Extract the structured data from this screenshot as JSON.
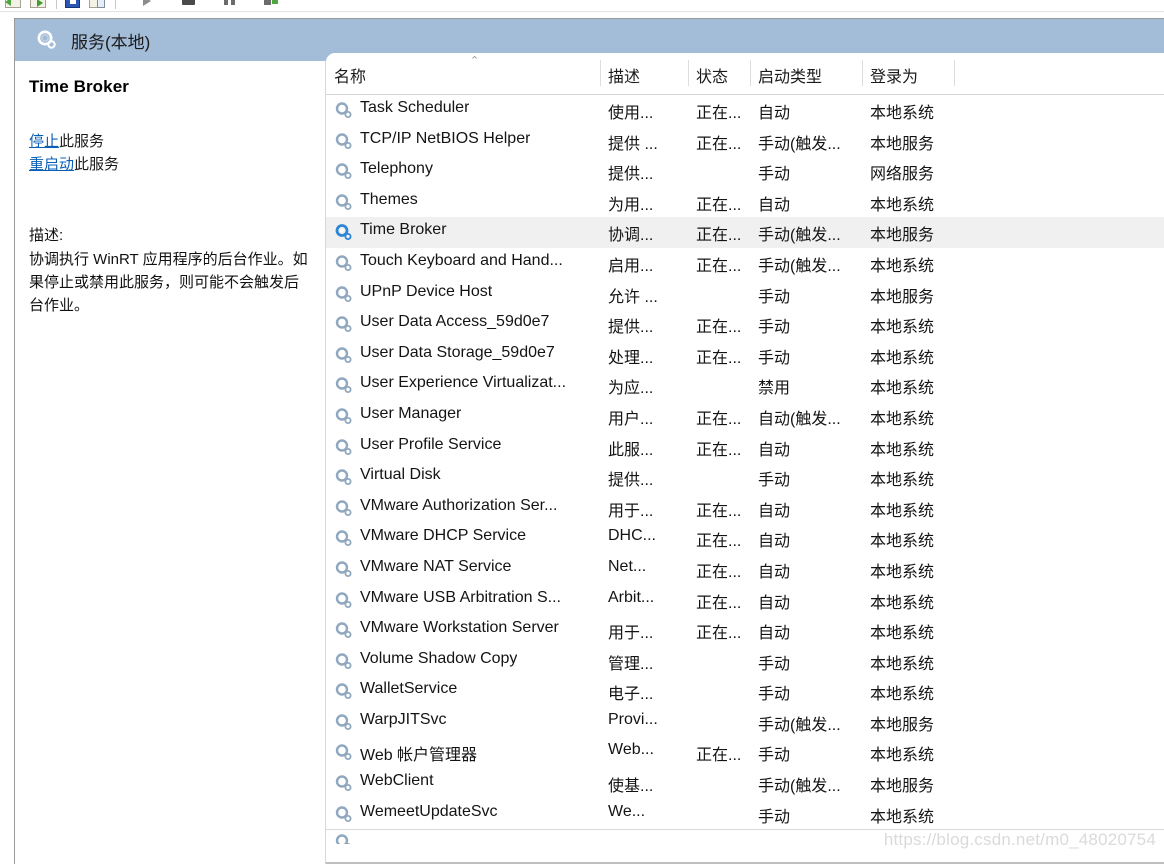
{
  "toolbar": {
    "buttons": [
      {
        "name": "export-list-icon",
        "kind": "doc-green-left"
      },
      {
        "name": "properties-icon",
        "kind": "doc-green-right"
      },
      {
        "name": "help-icon",
        "kind": "blue-square"
      },
      {
        "name": "show-hide-console-tree-icon",
        "kind": "doc-split"
      },
      {
        "name": "start-service-icon",
        "kind": "play"
      },
      {
        "name": "stop-service-icon",
        "kind": "stop"
      },
      {
        "name": "pause-service-icon",
        "kind": "pause"
      },
      {
        "name": "restart-service-icon",
        "kind": "restart"
      }
    ]
  },
  "header": {
    "icon": "services-gear-icon",
    "title": "服务(本地)"
  },
  "details": {
    "service_name": "Time Broker",
    "links": [
      {
        "link_text": "停止",
        "suffix": "此服务"
      },
      {
        "link_text": "重启动",
        "suffix": "此服务"
      }
    ],
    "description_label": "描述:",
    "description_text": "协调执行 WinRT 应用程序的后台作业。如果停止或禁用此服务，则可能不会触发后台作业。"
  },
  "list": {
    "sort_caret": "⌃",
    "columns": [
      {
        "key": "name",
        "label": "名称"
      },
      {
        "key": "desc",
        "label": "描述"
      },
      {
        "key": "state",
        "label": "状态"
      },
      {
        "key": "start",
        "label": "启动类型"
      },
      {
        "key": "logon",
        "label": "登录为"
      }
    ],
    "selected_index": 4,
    "rows": [
      {
        "icon": "service-gear-icon",
        "name": "Task Scheduler",
        "desc": "使用...",
        "state": "正在...",
        "start": "自动",
        "logon": "本地系统"
      },
      {
        "icon": "service-gear-icon",
        "name": "TCP/IP NetBIOS Helper",
        "desc": "提供 ...",
        "state": "正在...",
        "start": "手动(触发...",
        "logon": "本地服务"
      },
      {
        "icon": "service-gear-icon",
        "name": "Telephony",
        "desc": "提供...",
        "state": "",
        "start": "手动",
        "logon": "网络服务"
      },
      {
        "icon": "service-gear-icon",
        "name": "Themes",
        "desc": "为用...",
        "state": "正在...",
        "start": "自动",
        "logon": "本地系统"
      },
      {
        "icon": "service-gear-icon",
        "name": "Time Broker",
        "desc": "协调...",
        "state": "正在...",
        "start": "手动(触发...",
        "logon": "本地服务"
      },
      {
        "icon": "service-gear-icon",
        "name": "Touch Keyboard and Hand...",
        "desc": "启用...",
        "state": "正在...",
        "start": "手动(触发...",
        "logon": "本地系统"
      },
      {
        "icon": "service-gear-icon",
        "name": "UPnP Device Host",
        "desc": "允许 ...",
        "state": "",
        "start": "手动",
        "logon": "本地服务"
      },
      {
        "icon": "service-gear-icon",
        "name": "User Data Access_59d0e7",
        "desc": "提供...",
        "state": "正在...",
        "start": "手动",
        "logon": "本地系统"
      },
      {
        "icon": "service-gear-icon",
        "name": "User Data Storage_59d0e7",
        "desc": "处理...",
        "state": "正在...",
        "start": "手动",
        "logon": "本地系统"
      },
      {
        "icon": "service-gear-icon",
        "name": "User Experience Virtualizat...",
        "desc": "为应...",
        "state": "",
        "start": "禁用",
        "logon": "本地系统"
      },
      {
        "icon": "service-gear-icon",
        "name": "User Manager",
        "desc": "用户...",
        "state": "正在...",
        "start": "自动(触发...",
        "logon": "本地系统"
      },
      {
        "icon": "service-gear-icon",
        "name": "User Profile Service",
        "desc": "此服...",
        "state": "正在...",
        "start": "自动",
        "logon": "本地系统"
      },
      {
        "icon": "service-gear-icon",
        "name": "Virtual Disk",
        "desc": "提供...",
        "state": "",
        "start": "手动",
        "logon": "本地系统"
      },
      {
        "icon": "service-gear-icon",
        "name": "VMware Authorization Ser...",
        "desc": "用于...",
        "state": "正在...",
        "start": "自动",
        "logon": "本地系统"
      },
      {
        "icon": "service-gear-icon",
        "name": "VMware DHCP Service",
        "desc": "DHC...",
        "state": "正在...",
        "start": "自动",
        "logon": "本地系统"
      },
      {
        "icon": "service-gear-icon",
        "name": "VMware NAT Service",
        "desc": "Net...",
        "state": "正在...",
        "start": "自动",
        "logon": "本地系统"
      },
      {
        "icon": "service-gear-icon",
        "name": "VMware USB Arbitration S...",
        "desc": "Arbit...",
        "state": "正在...",
        "start": "自动",
        "logon": "本地系统"
      },
      {
        "icon": "service-gear-icon",
        "name": "VMware Workstation Server",
        "desc": "用于...",
        "state": "正在...",
        "start": "自动",
        "logon": "本地系统"
      },
      {
        "icon": "service-gear-icon",
        "name": "Volume Shadow Copy",
        "desc": "管理...",
        "state": "",
        "start": "手动",
        "logon": "本地系统"
      },
      {
        "icon": "service-gear-icon",
        "name": "WalletService",
        "desc": "电子...",
        "state": "",
        "start": "手动",
        "logon": "本地系统"
      },
      {
        "icon": "service-gear-icon",
        "name": "WarpJITSvc",
        "desc": "Provi...",
        "state": "",
        "start": "手动(触发...",
        "logon": "本地服务"
      },
      {
        "icon": "service-gear-icon",
        "name": "Web 帐户管理器",
        "desc": "Web...",
        "state": "正在...",
        "start": "手动",
        "logon": "本地系统"
      },
      {
        "icon": "service-gear-icon",
        "name": "WebClient",
        "desc": "使基...",
        "state": "",
        "start": "手动(触发...",
        "logon": "本地服务"
      },
      {
        "icon": "service-gear-icon",
        "name": "WemeetUpdateSvc",
        "desc": "We...",
        "state": "",
        "start": "手动",
        "logon": "本地系统"
      }
    ]
  },
  "watermark": {
    "text": "https://blog.csdn.net/m0_48020754"
  },
  "colors": {
    "title_band": "#a3bcd8",
    "selection": "#f0f0f0",
    "link": "#0a5fb5",
    "gear_selected": "#2e86d8",
    "gear_normal": "#8fa8c0"
  }
}
